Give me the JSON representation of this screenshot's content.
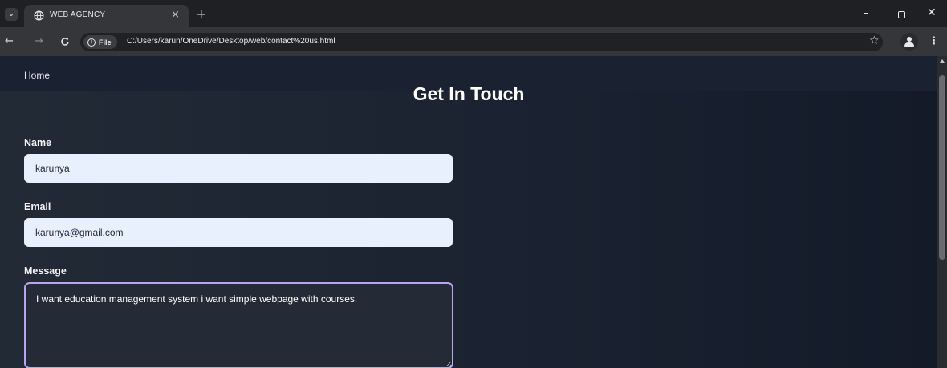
{
  "browser": {
    "tab_title": "WEB AGENCY",
    "tab_list_icon": "chevron-down-icon",
    "new_tab_glyph": "+",
    "close_tab_glyph": "×",
    "file_chip_label": "File",
    "url": "C:/Users/karun/OneDrive/Desktop/web/contact%20us.html",
    "bookmark_glyph": "☆",
    "menu_glyph": "⋮",
    "window_controls": {
      "minimize": "–",
      "close": "✕"
    },
    "nav_glyphs": {
      "back": "←",
      "forward": "→",
      "reload": "C"
    }
  },
  "page": {
    "nav": {
      "home_label": "Home"
    },
    "heading": "Get In Touch",
    "form": {
      "name_label": "Name",
      "name_value": "karunya",
      "email_label": "Email",
      "email_value": "karunya@gmail.com",
      "message_label": "Message",
      "message_value": "I want education management system i want simple webpage with courses."
    }
  },
  "colors": {
    "page_background": "#1a2231",
    "input_background": "#e9f0fd",
    "textarea_focus_border": "#b8a5f2",
    "browser_frame": "#35363a"
  }
}
